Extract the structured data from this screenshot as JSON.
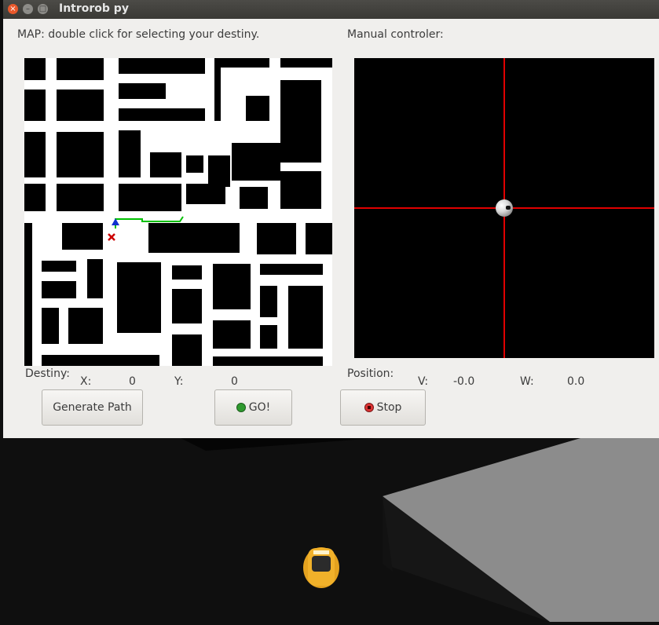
{
  "window": {
    "title": "Introrob py"
  },
  "map": {
    "label": "MAP: double click for selecting your destiny."
  },
  "controller": {
    "label": "Manual controler:"
  },
  "destiny": {
    "label": "Destiny:",
    "x_label": "X:",
    "x_value": "0",
    "y_label": "Y:",
    "y_value": "0"
  },
  "position": {
    "label": "Position:",
    "v_label": "V:",
    "v_value": "-0.0",
    "w_label": "W:",
    "w_value": "0.0"
  },
  "buttons": {
    "generate": "Generate Path",
    "go": "GO!",
    "stop": "Stop"
  },
  "colors": {
    "crosshair": "#ff0000",
    "path": "#00c000",
    "map_wall": "#000000",
    "map_road": "#ffffff"
  }
}
